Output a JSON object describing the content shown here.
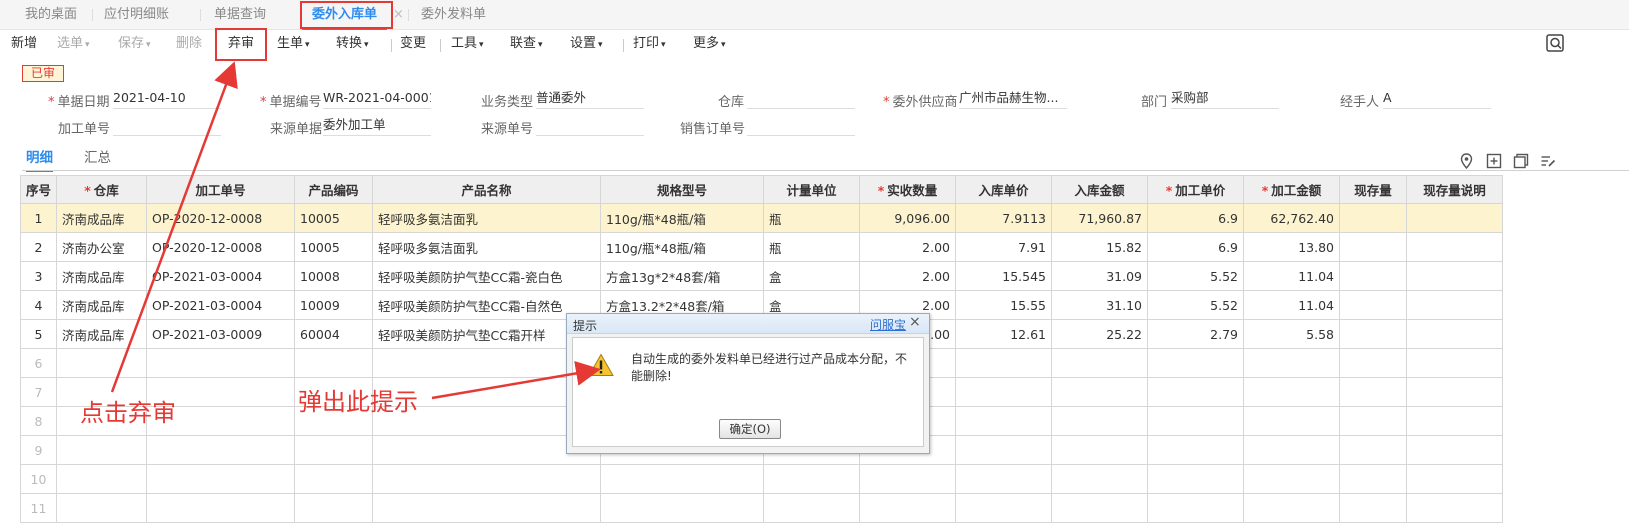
{
  "tabs": [
    {
      "label": "我的桌面"
    },
    {
      "label": "应付明细账"
    },
    {
      "label": "单据查询"
    },
    {
      "label": "委外入库单"
    },
    {
      "label": "委外发料单"
    }
  ],
  "tab_close": "×",
  "toolbar": {
    "new": "新增",
    "select": "选单",
    "save": "保存",
    "delete": "删除",
    "unaudit": "弃审",
    "generate": "生单",
    "convert": "转换",
    "change": "变更",
    "tools": "工具",
    "linked_query": "联查",
    "settings": "设置",
    "print": "打印",
    "more": "更多"
  },
  "status_badge": "已审",
  "form": {
    "doc_date": {
      "label": "单据日期",
      "value": "2021-04-10"
    },
    "doc_no": {
      "label": "单据编号",
      "value": "WR-2021-04-0001"
    },
    "biz_type": {
      "label": "业务类型",
      "value": "普通委外"
    },
    "warehouse": {
      "label": "仓库",
      "value": ""
    },
    "supplier": {
      "label": "委外供应商",
      "value": "广州市品赫生物..."
    },
    "dept": {
      "label": "部门",
      "value": "采购部"
    },
    "handler": {
      "label": "经手人",
      "value": "A"
    },
    "process_no": {
      "label": "加工单号",
      "value": ""
    },
    "source_doc": {
      "label": "来源单据",
      "value": "委外加工单"
    },
    "source_no": {
      "label": "来源单号",
      "value": ""
    },
    "sales_order_no": {
      "label": "销售订单号",
      "value": ""
    }
  },
  "subtabs": {
    "detail": "明细",
    "summary": "汇总"
  },
  "table": {
    "headers": [
      "序号",
      "仓库",
      "加工单号",
      "产品编码",
      "产品名称",
      "规格型号",
      "计量单位",
      "实收数量",
      "入库单价",
      "入库金额",
      "加工单价",
      "加工金额",
      "现存量",
      "现存量说明"
    ],
    "rows": [
      [
        "1",
        "济南成品库",
        "OP-2020-12-0008",
        "10005",
        "轻呼吸多氨洁面乳",
        "110g/瓶*48瓶/箱",
        "瓶",
        "9,096.00",
        "7.9113",
        "71,960.87",
        "6.9",
        "62,762.40",
        "",
        ""
      ],
      [
        "2",
        "济南办公室",
        "OP-2020-12-0008",
        "10005",
        "轻呼吸多氨洁面乳",
        "110g/瓶*48瓶/箱",
        "瓶",
        "2.00",
        "7.91",
        "15.82",
        "6.9",
        "13.80",
        "",
        ""
      ],
      [
        "3",
        "济南成品库",
        "OP-2021-03-0004",
        "10008",
        "轻呼吸美颜防护气垫CC霜-瓷白色",
        "方盒13g*2*48套/箱",
        "盒",
        "2.00",
        "15.545",
        "31.09",
        "5.52",
        "11.04",
        "",
        ""
      ],
      [
        "4",
        "济南成品库",
        "OP-2021-03-0004",
        "10009",
        "轻呼吸美颜防护气垫CC霜-自然色",
        "方盒13.2*2*48套/箱",
        "盒",
        "2.00",
        "15.55",
        "31.10",
        "5.52",
        "11.04",
        "",
        ""
      ],
      [
        "5",
        "济南成品库",
        "OP-2021-03-0009",
        "60004",
        "轻呼吸美颜防护气垫CC霜开样",
        "",
        "",
        "2.00",
        "12.61",
        "25.22",
        "2.79",
        "5.58",
        "",
        ""
      ]
    ],
    "empty_rows": [
      "6",
      "7",
      "8",
      "9",
      "10",
      "11"
    ]
  },
  "dialog": {
    "title": "提示",
    "help_link": "问服宝",
    "close": "×",
    "message": "自动生成的委外发料单已经进行过产品成本分配，不能删除!",
    "ok_button": "确定(O)"
  },
  "annotations": {
    "click_unaudit": "点击弃审",
    "popup_hint": "弹出此提示"
  },
  "colors": {
    "accent": "#2d8cf0",
    "annotation": "#e53935",
    "selected_row": "#fdf4cf"
  }
}
